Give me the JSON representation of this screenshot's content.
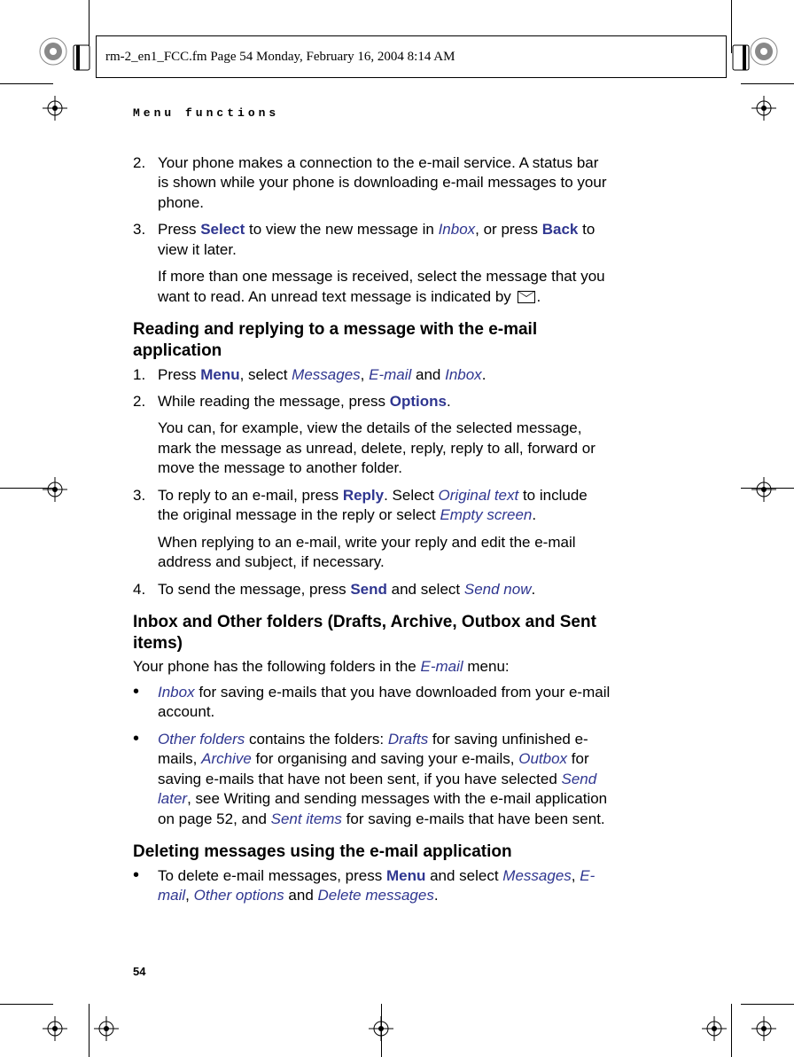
{
  "header": {
    "running": "rm-2_en1_FCC.fm  Page 54  Monday, February 16, 2004  8:14 AM"
  },
  "section_label": "Menu functions",
  "page_number": "54",
  "intro_steps": [
    {
      "num": "2.",
      "paras": [
        [
          {
            "t": "Your phone makes a connection to the e-mail service. A status bar is shown while your phone is downloading e-mail messages to your phone."
          }
        ]
      ]
    },
    {
      "num": "3.",
      "paras": [
        [
          {
            "t": "Press "
          },
          {
            "t": "Select",
            "cls": "term-b"
          },
          {
            "t": " to view the new message in "
          },
          {
            "t": "Inbox",
            "cls": "term-i"
          },
          {
            "t": ", or press "
          },
          {
            "t": "Back",
            "cls": "term-b"
          },
          {
            "t": " to view it later."
          }
        ],
        [
          {
            "t": "If more than one message is received, select the message that you want to read. An unread text message is indicated by "
          },
          {
            "icon": "envelope"
          },
          {
            "t": "."
          }
        ]
      ]
    }
  ],
  "h1": "Reading and replying to a message with the e-mail application",
  "reading_steps": [
    {
      "num": "1.",
      "paras": [
        [
          {
            "t": "Press "
          },
          {
            "t": "Menu",
            "cls": "term-b"
          },
          {
            "t": ", select "
          },
          {
            "t": "Messages",
            "cls": "term-i"
          },
          {
            "t": ", "
          },
          {
            "t": "E-mail",
            "cls": "term-i"
          },
          {
            "t": " and "
          },
          {
            "t": "Inbox",
            "cls": "term-i"
          },
          {
            "t": "."
          }
        ]
      ]
    },
    {
      "num": "2.",
      "paras": [
        [
          {
            "t": "While reading the message, press "
          },
          {
            "t": "Options",
            "cls": "term-b"
          },
          {
            "t": "."
          }
        ],
        [
          {
            "t": "You can, for example, view the details of the selected message, mark the message as unread, delete, reply, reply to all, forward or move the message to another folder."
          }
        ]
      ]
    },
    {
      "num": "3.",
      "paras": [
        [
          {
            "t": "To reply to an e-mail, press "
          },
          {
            "t": "Reply",
            "cls": "term-b"
          },
          {
            "t": ". Select "
          },
          {
            "t": "Original text",
            "cls": "term-i"
          },
          {
            "t": " to include the original message in the reply or select "
          },
          {
            "t": "Empty screen",
            "cls": "term-i"
          },
          {
            "t": "."
          }
        ],
        [
          {
            "t": "When replying to an e-mail, write your reply and edit the e-mail address and subject, if necessary."
          }
        ]
      ]
    },
    {
      "num": "4.",
      "paras": [
        [
          {
            "t": "To send the message, press "
          },
          {
            "t": "Send",
            "cls": "term-b"
          },
          {
            "t": " and select "
          },
          {
            "t": "Send now",
            "cls": "term-i"
          },
          {
            "t": "."
          }
        ]
      ]
    }
  ],
  "h2": "Inbox and Other folders (Drafts, Archive, Outbox and Sent items)",
  "h2_intro": [
    {
      "t": "Your phone has the following folders in the "
    },
    {
      "t": "E-mail",
      "cls": "term-i"
    },
    {
      "t": " menu:"
    }
  ],
  "folder_bullets": [
    [
      {
        "t": "Inbox",
        "cls": "term-i"
      },
      {
        "t": " for saving e-mails that you have downloaded from your e-mail account."
      }
    ],
    [
      {
        "t": "Other folders",
        "cls": "term-i"
      },
      {
        "t": " contains the folders: "
      },
      {
        "t": "Drafts",
        "cls": "term-i"
      },
      {
        "t": " for saving unfinished e-mails, "
      },
      {
        "t": "Archive",
        "cls": "term-i"
      },
      {
        "t": " for organising and saving your e-mails, "
      },
      {
        "t": "Outbox",
        "cls": "term-i"
      },
      {
        "t": " for saving e-mails that have not been sent, if you have selected "
      },
      {
        "t": "Send later",
        "cls": "term-i"
      },
      {
        "t": ", see Writing and sending messages with the e-mail application on page 52, and "
      },
      {
        "t": "Sent items",
        "cls": "term-i"
      },
      {
        "t": " for saving e-mails that have been sent."
      }
    ]
  ],
  "h3": "Deleting messages using the e-mail application",
  "delete_bullets": [
    [
      {
        "t": "To delete e-mail messages, press "
      },
      {
        "t": "Menu",
        "cls": "term-b"
      },
      {
        "t": " and select "
      },
      {
        "t": "Messages",
        "cls": "term-i"
      },
      {
        "t": ",  "
      },
      {
        "t": "E-mail",
        "cls": "term-i"
      },
      {
        "t": ", "
      },
      {
        "t": "Other options",
        "cls": "term-i"
      },
      {
        "t": " and "
      },
      {
        "t": "Delete messages",
        "cls": "term-i"
      },
      {
        "t": "."
      }
    ]
  ]
}
